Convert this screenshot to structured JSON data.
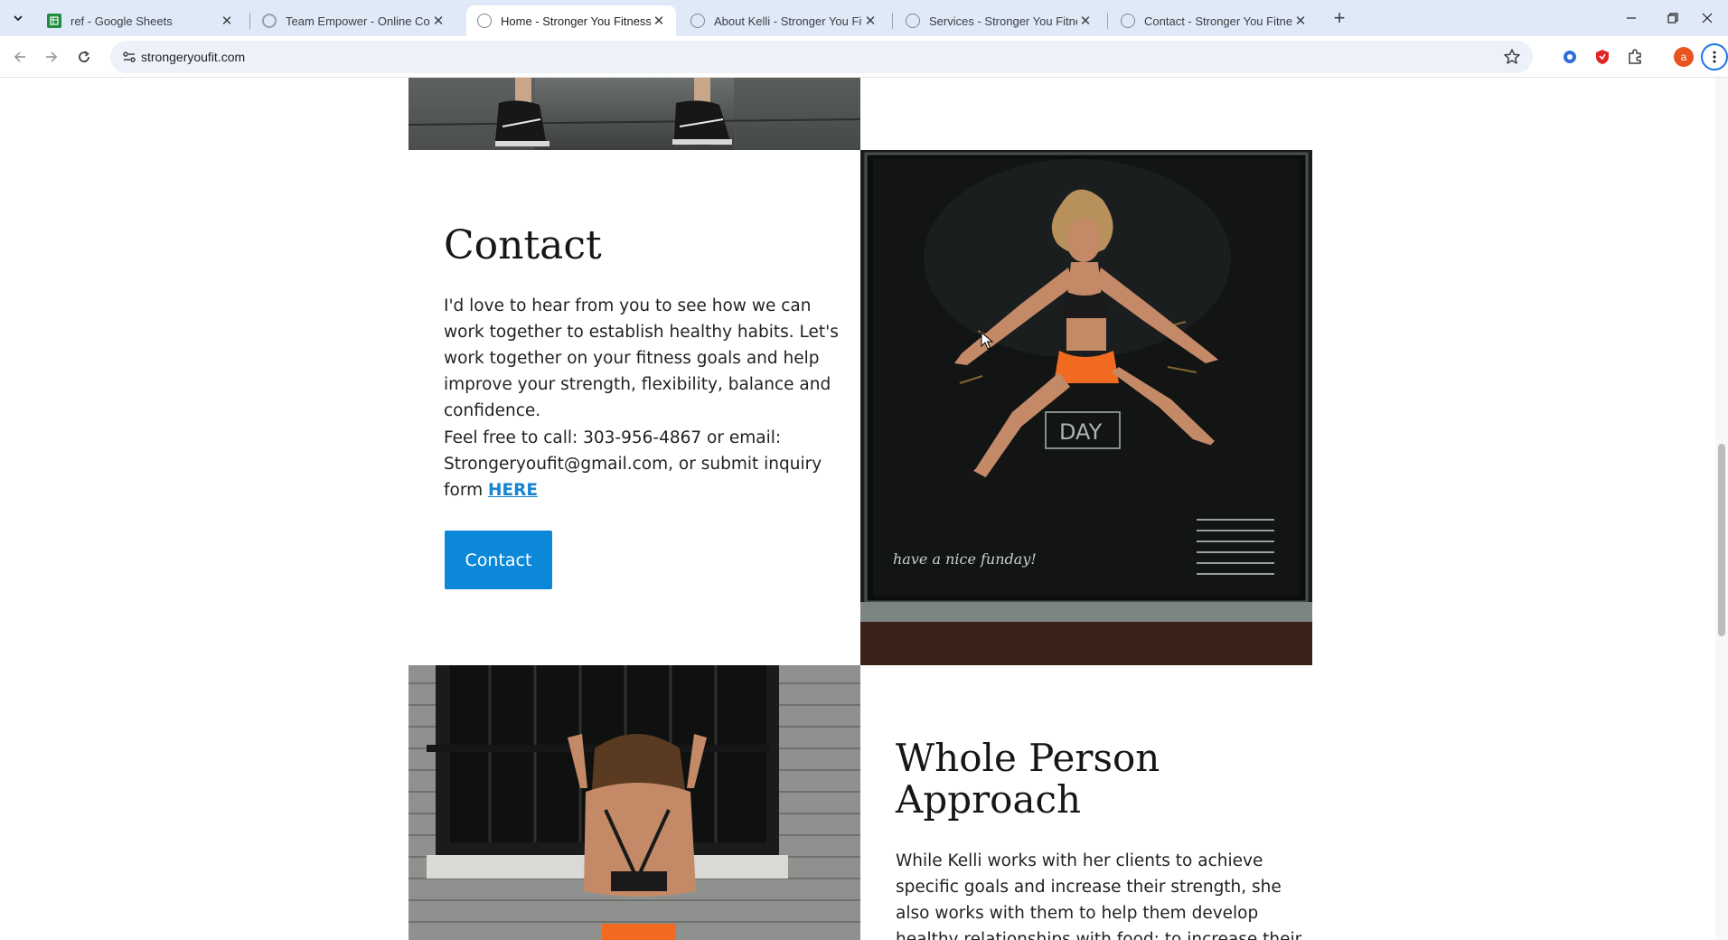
{
  "browser": {
    "tabs": [
      {
        "title": "ref - Google Sheets",
        "favicon": "sheets-icon",
        "active": false
      },
      {
        "title": "Team Empower - Online Coachi",
        "favicon": "page-icon",
        "active": false
      },
      {
        "title": "Home - Stronger You Fitness",
        "favicon": "globe-icon",
        "active": true
      },
      {
        "title": "About Kelli - Stronger You Fitne",
        "favicon": "globe-icon",
        "active": false
      },
      {
        "title": "Services - Stronger You Fitness",
        "favicon": "globe-icon",
        "active": false
      },
      {
        "title": "Contact - Stronger You Fitness",
        "favicon": "globe-icon",
        "active": false
      }
    ],
    "close_glyph": "✕",
    "new_tab_glyph": "+",
    "url": "strongeryoufit.com",
    "profile_initial": "a",
    "colors": {
      "tabbar": "#dfe9f8",
      "omnibox": "#edf2fa"
    }
  },
  "contact_section": {
    "heading": "Contact",
    "paragraph1": "I'd love to hear from you to see how we can work together to establish healthy habits. Let's work together on your fitness goals and help improve your strength, flexibility, balance and confidence.",
    "paragraph2_prefix": "Feel free to call: 303-956-4867 or email: Strongeryoufit@gmail.com, or submit inquiry form",
    "paragraph2_link": "HERE",
    "button_label": "Contact",
    "button_color": "#0b88d8",
    "link_color": "#1585d1"
  },
  "photo_overlay": {
    "window_sign": "DAY",
    "script_text": "have a nice funday!"
  },
  "whole_person_section": {
    "heading_line1": "Whole Person",
    "heading_line2": "Approach",
    "paragraph_lines": [
      "While Kelli works with her clients to achieve",
      "specific goals and increase their strength, she",
      "also works with them to help them develop",
      "healthy relationships with food; to increase their"
    ]
  }
}
